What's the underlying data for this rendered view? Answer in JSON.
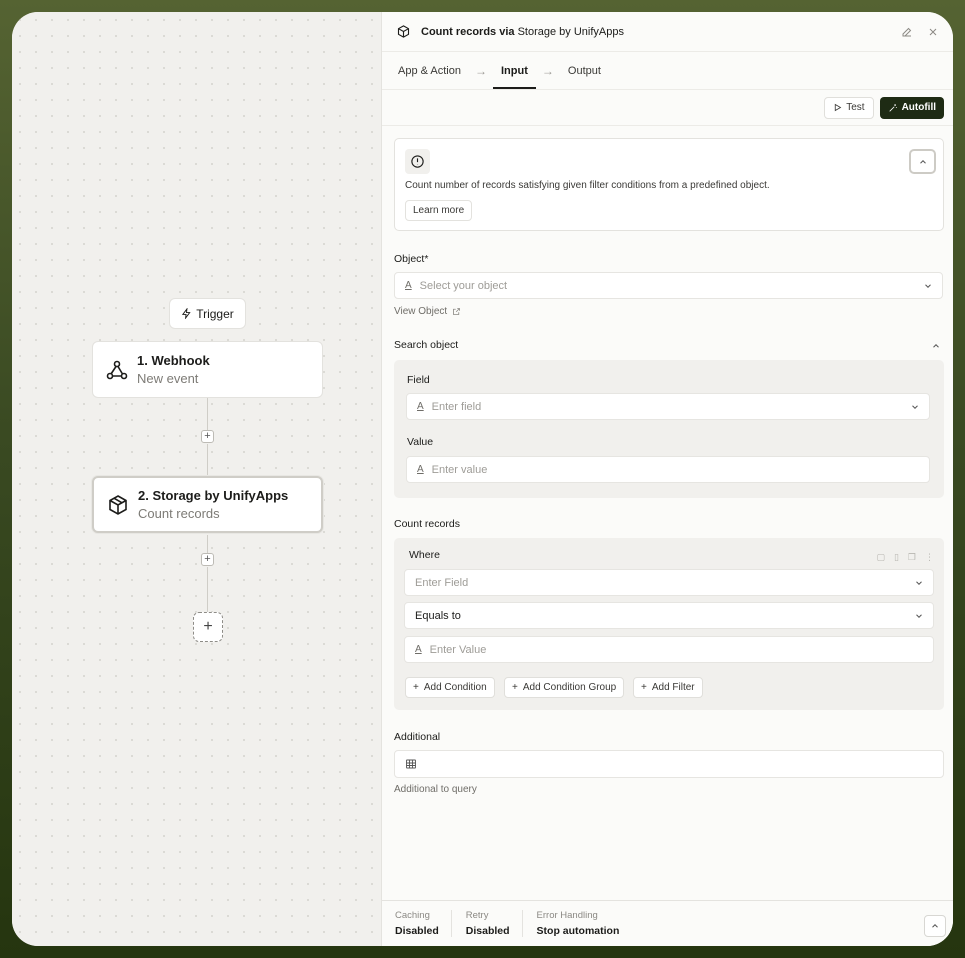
{
  "canvas": {
    "trigger_label": "Trigger",
    "nodes": [
      {
        "title": "1. Webhook",
        "subtitle": "New event"
      },
      {
        "title": "2. Storage by UnifyApps",
        "subtitle": "Count records"
      }
    ]
  },
  "panel": {
    "header": {
      "title_bold": "Count records via",
      "title_rest": "Storage by UnifyApps"
    },
    "tabs": [
      "App & Action",
      "Input",
      "Output"
    ],
    "toolbar": {
      "test_label": "Test",
      "autofill_label": "Autofill"
    },
    "info": {
      "text": "Count number of records satisfying given filter conditions from a predefined object.",
      "learn_more": "Learn more"
    },
    "object": {
      "label": "Object*",
      "placeholder": "Select your object",
      "view_link": "View Object"
    },
    "search_object": {
      "label": "Search object",
      "field_label": "Field",
      "field_placeholder": "Enter field",
      "value_label": "Value",
      "value_placeholder": "Enter value"
    },
    "count_records": {
      "label": "Count records",
      "where_label": "Where",
      "field_placeholder": "Enter Field",
      "operator_value": "Equals to",
      "value_placeholder": "Enter Value",
      "add_condition": "Add Condition",
      "add_condition_group": "Add Condition Group",
      "add_filter": "Add Filter"
    },
    "additional": {
      "label": "Additional",
      "help": "Additional to query"
    },
    "footer": [
      {
        "key": "Caching",
        "value": "Disabled"
      },
      {
        "key": "Retry",
        "value": "Disabled"
      },
      {
        "key": "Error Handling",
        "value": "Stop automation"
      }
    ]
  }
}
